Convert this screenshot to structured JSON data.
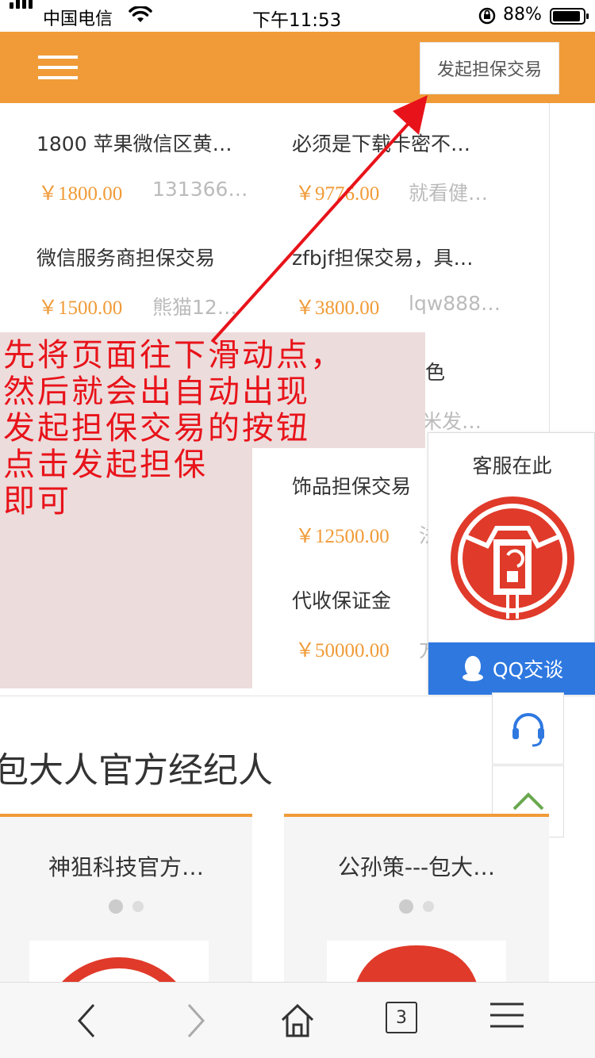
{
  "status_bar": {
    "carrier": "中国电信",
    "time": "下午11:53",
    "battery": "88%"
  },
  "header": {
    "launch_button": "发起担保交易"
  },
  "listings": [
    {
      "title": "1800 苹果微信区黄…",
      "price": "￥1800.00",
      "seller": "131366…"
    },
    {
      "title": "必须是下载卡密不…",
      "price": "￥9776.00",
      "seller": "就看健…"
    },
    {
      "title": "微信服务商担保交易",
      "price": "￥1500.00",
      "seller": "熊猫12…"
    },
    {
      "title": "zfbjf担保交易，具…",
      "price": "￥3800.00",
      "seller": "lqw888…"
    },
    {
      "title": "色",
      "price": "",
      "seller": "米发…"
    },
    {
      "title": "饰品担保交易",
      "price": "￥12500.00",
      "seller": "法"
    },
    {
      "title": "代收保证金",
      "price": "￥50000.00",
      "seller": "方"
    }
  ],
  "annotation": {
    "lines": [
      "先将页面往下滑动点，",
      "然后就会出自动出现",
      "发起担保交易的按钮",
      "点击发起担保",
      "即可"
    ],
    "color": "#e8131a"
  },
  "customer_service": {
    "title": "客服在此",
    "qq_button": "QQ交谈"
  },
  "agents_section": {
    "title": "包大人官方经纪人",
    "cards": [
      {
        "name": "神狙科技官方…"
      },
      {
        "name": "公孙策---包大…"
      }
    ]
  },
  "browser_bar": {
    "tab_count": "3"
  },
  "colors": {
    "brand_orange": "#f09b38",
    "qq_blue": "#2e78e0",
    "annotation_red": "#e8131a"
  }
}
